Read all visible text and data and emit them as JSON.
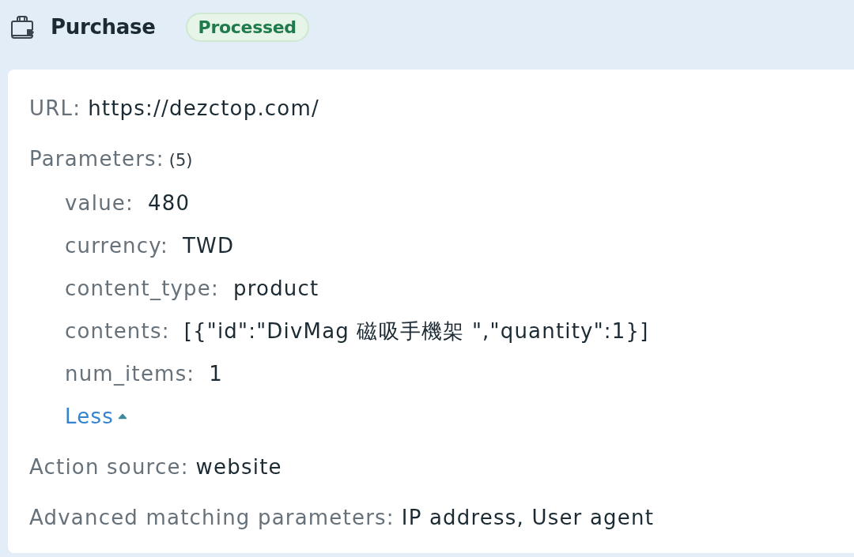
{
  "header": {
    "title": "Purchase",
    "status": "Processed"
  },
  "details": [
    {
      "kind": "field",
      "label": "URL:",
      "value": "https://dezctop.com/"
    },
    {
      "kind": "group",
      "label": "Parameters:",
      "count": "(5)",
      "expanded": true,
      "toggle": "Less",
      "items": [
        {
          "name": "value:",
          "value": "480"
        },
        {
          "name": "currency:",
          "value": "TWD"
        },
        {
          "name": "content_type:",
          "value": "product"
        },
        {
          "name": "contents:",
          "value": "[{\"id\":\"DivMag 磁吸手機架 \",\"quantity\":1}]"
        },
        {
          "name": "num_items:",
          "value": "1"
        }
      ]
    },
    {
      "kind": "field",
      "label": "Action source:",
      "value": "website"
    },
    {
      "kind": "field",
      "label": "Advanced matching parameters:",
      "value": "IP address, User agent"
    }
  ]
}
